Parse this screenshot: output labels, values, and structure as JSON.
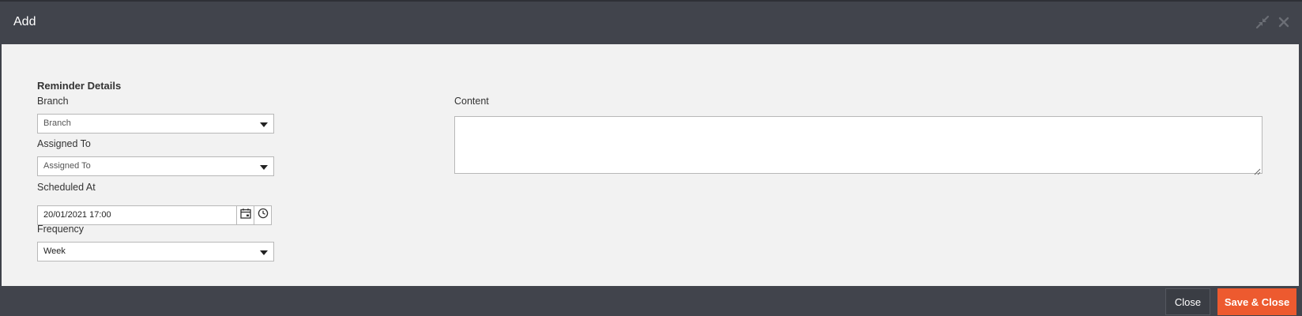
{
  "dialog": {
    "title": "Add",
    "minimize_icon": "compress-arrows-icon",
    "close_icon": "close-x-icon"
  },
  "form": {
    "section_title": "Reminder Details",
    "branch": {
      "label": "Branch",
      "placeholder": "Branch"
    },
    "assigned_to": {
      "label": "Assigned To",
      "placeholder": "Assigned To"
    },
    "scheduled_at": {
      "label": "Scheduled At",
      "value": "20/01/2021 17:00",
      "calendar_icon": "calendar-icon",
      "clock_icon": "clock-icon"
    },
    "frequency": {
      "label": "Frequency",
      "value": "Week"
    },
    "content": {
      "label": "Content",
      "value": ""
    }
  },
  "footer": {
    "close_label": "Close",
    "save_close_label": "Save & Close"
  },
  "colors": {
    "header_bg": "#41444c",
    "body_bg": "#f2f2f2",
    "accent": "#ed5a2f"
  }
}
